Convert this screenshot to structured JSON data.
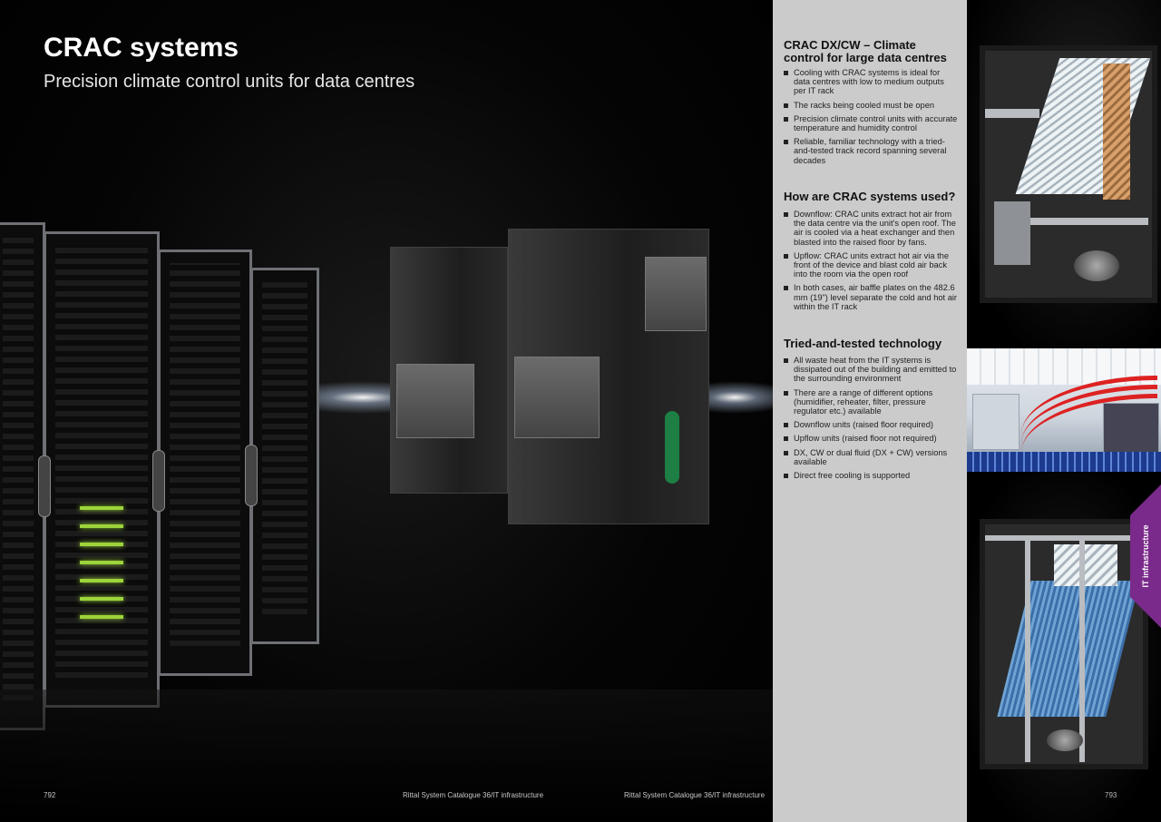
{
  "hero": {
    "title": "CRAC systems",
    "subtitle": "Precision climate control units for data centres"
  },
  "sections": [
    {
      "heading_lines": [
        "CRAC DX/CW – Climate",
        "control for large data centres"
      ],
      "items": [
        "Cooling with CRAC systems is ideal for data centres with low to medium outputs per IT rack",
        "The racks being cooled must be open",
        "Precision climate control units with accurate temperature and humidity control",
        "Reliable, familiar technology with a tried-and-tested track record spanning several decades"
      ]
    },
    {
      "heading_lines": [
        "How are CRAC systems used?"
      ],
      "items": [
        "Downflow: CRAC units extract hot air from the data centre via the unit's open roof. The air is cooled via a heat exchanger and then blasted into the raised floor by fans.",
        "Upflow: CRAC units extract hot air via the front of the device and blast cold air back into the room via the open roof",
        "In both cases, air baffle plates on the 482.6 mm (19\") level separate the cold and hot air within the IT rack"
      ]
    },
    {
      "heading_lines": [
        "Tried-and-tested technology"
      ],
      "items": [
        "All waste heat from the IT systems is dissipated out of the building and emitted to the surrounding environment",
        "There are a range of different options (humidifier, reheater, filter, pressure regulator etc.) available",
        "Downflow units (raised floor required)",
        "Upflow units (raised floor not required)",
        "DX, CW or dual fluid (DX + CW) versions available",
        "Direct free cooling is supported"
      ]
    }
  ],
  "footer": {
    "page_left": "792",
    "catalogue_left": "Rittal System Catalogue 36/IT infrastructure",
    "catalogue_right": "Rittal System Catalogue 36/IT infrastructure",
    "page_right": "793"
  },
  "side_tab": {
    "label": "IT infrastructure"
  },
  "colors": {
    "accent": "#7a2a8a",
    "column_bg": "#cbcbcb"
  }
}
